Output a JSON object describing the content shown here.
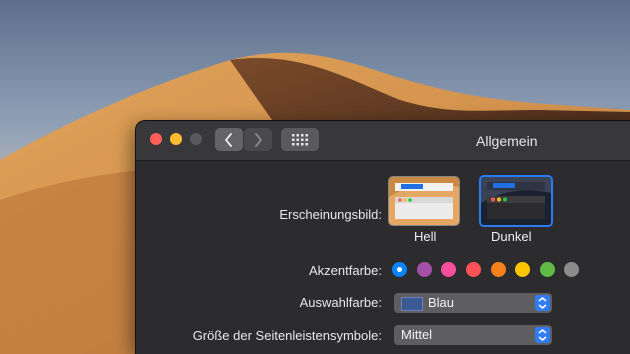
{
  "window": {
    "title": "Allgemein"
  },
  "appearance": {
    "label": "Erscheinungsbild:",
    "options": [
      {
        "label": "Hell",
        "selected": false
      },
      {
        "label": "Dunkel",
        "selected": true
      }
    ]
  },
  "accent": {
    "label": "Akzentfarbe:",
    "colors": [
      "#0a84ff",
      "#a550a7",
      "#f74f9e",
      "#ff5257",
      "#f7821b",
      "#ffc600",
      "#62ba46",
      "#8c8c8c"
    ],
    "selected_index": 0
  },
  "highlight": {
    "label": "Auswahlfarbe:",
    "value": "Blau",
    "swatch_color": "#3a5a94"
  },
  "sidebar_icon_size": {
    "label": "Größe der Seitenleistensymbole:",
    "value": "Mittel"
  }
}
